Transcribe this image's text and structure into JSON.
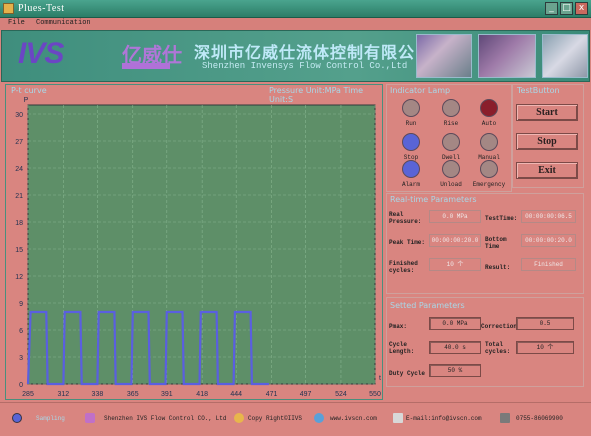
{
  "window": {
    "title": "Plues-Test",
    "min": "_",
    "max": "□",
    "close": "x"
  },
  "menu": [
    "File",
    "Communication"
  ],
  "banner": {
    "logo": "IVS",
    "logo_cn": "亿威仕",
    "company_cn": "深圳市亿威仕流体控制有限公司",
    "company_en": "Shenzhen Invensys Flow Control Co.,Ltd"
  },
  "chart_panel": {
    "title": "P-t curve",
    "units": "Pressure Unit:MPa   Time Unit:S"
  },
  "chart_data": {
    "type": "line",
    "xlabel": "t",
    "ylabel": "P",
    "x_ticks": [
      285,
      312,
      338,
      365,
      391,
      418,
      444,
      471,
      497,
      524,
      550
    ],
    "y_ticks": [
      0,
      3,
      6,
      9,
      12,
      15,
      18,
      21,
      24,
      27,
      30
    ],
    "xlim": [
      285,
      550
    ],
    "ylim": [
      0,
      31
    ],
    "grid": true,
    "series": [
      {
        "color": "#5a5fe0",
        "x": [
          285,
          287,
          299,
          300,
          312,
          313,
          325,
          326,
          338,
          339,
          351,
          352,
          364,
          365,
          377,
          378,
          390,
          391,
          403,
          404,
          416,
          417,
          429,
          430,
          442,
          443,
          455,
          456,
          469
        ],
        "y": [
          0,
          8,
          8,
          0,
          0,
          8,
          8,
          0,
          0,
          8,
          8,
          0,
          0,
          8,
          8,
          0,
          0,
          8,
          8,
          0,
          0,
          8,
          8,
          0,
          0,
          8,
          8,
          0,
          0
        ]
      }
    ]
  },
  "indicator": {
    "title": "Indicator Lamp",
    "lamps": [
      {
        "label": "Run",
        "state": "off"
      },
      {
        "label": "Rise",
        "state": "off"
      },
      {
        "label": "Auto",
        "state": "red"
      },
      {
        "label": "Stop",
        "state": "blue"
      },
      {
        "label": "Dwell",
        "state": "off"
      },
      {
        "label": "Manual",
        "state": "off"
      },
      {
        "label": "Alarm",
        "state": "blue"
      },
      {
        "label": "Unload",
        "state": "off"
      },
      {
        "label": "Emergency",
        "state": "off"
      }
    ]
  },
  "test_buttons": {
    "title": "TestButton",
    "start": "Start",
    "stop": "Stop",
    "exit": "Exit"
  },
  "realtime": {
    "title": "Real-time Parameters",
    "real_pressure_label": "Real Pressure:",
    "real_pressure_value": "0.0 MPa",
    "test_time_label": "TestTime:",
    "test_time_value": "00:00:00:06.5",
    "peak_time_label": "Peak Time:",
    "peak_time_value": "00:00:00:20.0",
    "bottom_time_label": "Bottom Time",
    "bottom_time_value": "00:00:00:20.0",
    "finished_cycles_label": "Finished cycles:",
    "finished_cycles_value": "10 个",
    "result_label": "Result:",
    "result_value": "Finished"
  },
  "setted": {
    "title": "Setted Parameters",
    "pmax_label": "Pmax:",
    "pmax_value": "0.0 MPa",
    "correction_label": "Correction:",
    "correction_value": "0.5",
    "cycle_length_label": "Cycle Length:",
    "cycle_length_value": "40.0 s",
    "total_cycles_label": "Total cycles:",
    "total_cycles_value": "10 个",
    "duty_cycle_label": "Duty Cycle",
    "duty_cycle_value": "50 %"
  },
  "status": {
    "sampling": "Sampling",
    "company": "Shenzhen IVS Flow Control CO., Ltd",
    "copyright": "Copy Right©IIVS",
    "web": "www.ivscn.com",
    "email": "E-mail:info@ivscn.com",
    "phone": "0755-86069900"
  }
}
